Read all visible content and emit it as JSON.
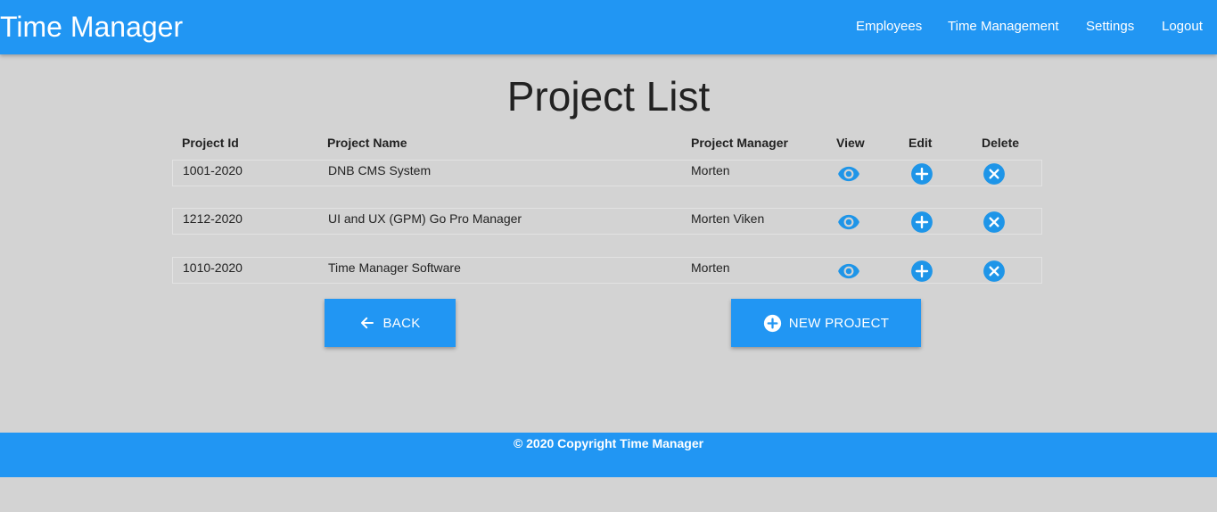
{
  "app": {
    "title": "Time Manager"
  },
  "nav": {
    "items": [
      {
        "label": "Employees"
      },
      {
        "label": "Time Management"
      },
      {
        "label": "Settings"
      },
      {
        "label": "Logout"
      }
    ]
  },
  "page": {
    "title": "Project List"
  },
  "table": {
    "headers": [
      "Project Id",
      "Project Name",
      "Project Manager",
      "View",
      "Edit",
      "Delete"
    ],
    "rows": [
      {
        "id": "1001-2020",
        "name": "DNB CMS System",
        "manager": "Morten"
      },
      {
        "id": "1212-2020",
        "name": "UI and UX (GPM) Go Pro Manager",
        "manager": "Morten Viken"
      },
      {
        "id": "1010-2020",
        "name": "Time Manager Software",
        "manager": "Morten"
      }
    ],
    "icons": {
      "view": "eye-icon",
      "edit": "plus-circle-icon",
      "delete": "x-circle-icon"
    }
  },
  "actions": {
    "back_label": "BACK",
    "new_project_label": "NEW PROJECT"
  },
  "footer": {
    "text": "© 2020 Copyright Time Manager"
  },
  "colors": {
    "primary": "#2196f3",
    "background": "#d3d3d3",
    "icon": "#1e95e8"
  }
}
